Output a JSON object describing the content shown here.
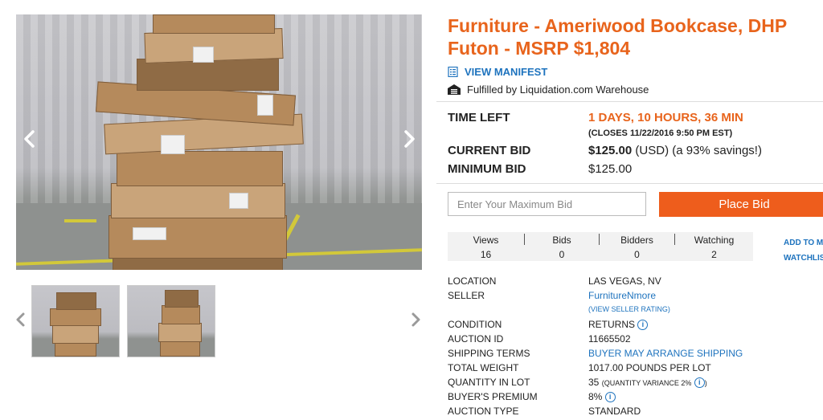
{
  "listing": {
    "title": "Furniture - Ameriwood Bookcase, DHP Futon - MSRP $1,804",
    "manifest_label": "VIEW MANIFEST",
    "fulfilled_text": "Fulfilled by Liquidation.com Warehouse"
  },
  "bid": {
    "time_left_label": "TIME LEFT",
    "time_left_value": "1 DAYS, 10 HOURS, 36 MIN",
    "closes_text": "(CLOSES 11/22/2016 9:50 PM EST)",
    "current_bid_label": "CURRENT BID",
    "current_bid_amount": "$125.00",
    "current_bid_suffix": "(USD) (a 93% savings!)",
    "minimum_bid_label": "MINIMUM BID",
    "minimum_bid_value": "$125.00",
    "input_placeholder": "Enter Your Maximum Bid",
    "place_bid_label": "Place Bid"
  },
  "stats": {
    "views_label": "Views",
    "views_value": "16",
    "bids_label": "Bids",
    "bids_value": "0",
    "bidders_label": "Bidders",
    "bidders_value": "0",
    "watching_label": "Watching",
    "watching_value": "2",
    "watchlist_line1": "ADD TO M",
    "watchlist_line2": "WATCHLIS"
  },
  "details": {
    "location_label": "LOCATION",
    "location_value": "LAS VEGAS, NV",
    "seller_label": "SELLER",
    "seller_value": "FurnitureNmore",
    "seller_rating_link": "(VIEW SELLER RATING)",
    "condition_label": "CONDITION",
    "condition_value": "RETURNS",
    "auction_id_label": "AUCTION ID",
    "auction_id_value": "11665502",
    "shipping_label": "SHIPPING TERMS",
    "shipping_value": "BUYER MAY ARRANGE SHIPPING",
    "weight_label": "TOTAL WEIGHT",
    "weight_value": "1017.00 POUNDS PER LOT",
    "quantity_label": "QUANTITY IN LOT",
    "quantity_value": "35",
    "quantity_variance": "(QUANTITY VARIANCE 2%",
    "quantity_variance_close": ")",
    "premium_label": "BUYER'S PREMIUM",
    "premium_value": "8%",
    "auction_type_label": "AUCTION TYPE",
    "auction_type_value": "STANDARD",
    "info_glyph": "i"
  },
  "icons": {
    "manifest": "document-list-icon",
    "warehouse": "warehouse-icon",
    "prev": "chevron-left-icon",
    "next": "chevron-right-icon"
  },
  "colors": {
    "title_orange": "#e8641c",
    "button_orange": "#ee5d1c",
    "link_blue": "#1e73be"
  }
}
